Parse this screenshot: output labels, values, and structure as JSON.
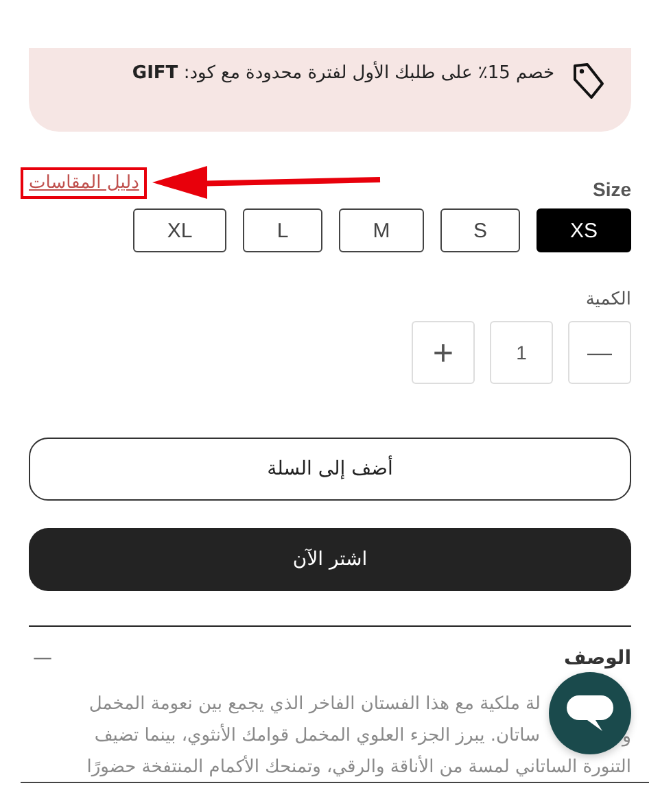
{
  "promo": {
    "text": "خصم 15٪ على طلبك الأول لفترة محدودة مع كود: **GIFT**"
  },
  "size": {
    "label": "Size",
    "guide_link": "دليل المقاسات",
    "options": [
      {
        "label": "XS",
        "selected": true
      },
      {
        "label": "S",
        "selected": false
      },
      {
        "label": "M",
        "selected": false
      },
      {
        "label": "L",
        "selected": false
      },
      {
        "label": "XL",
        "selected": false
      }
    ]
  },
  "quantity": {
    "label": "الكمية",
    "decrement": "—",
    "value": "1",
    "increment": "+"
  },
  "buttons": [
    {
      "label": "أضف إلى السلة",
      "kind": "outline"
    },
    {
      "label": "اشتر الآن",
      "kind": "filled"
    }
  ],
  "description": {
    "toggle": "—",
    "title": "الوصف",
    "lines": [
      {
        "text": "لة ملكية مع هذا الفستان الفاخر الذي يجمع بين نعومة المخمل"
      },
      {
        "start": "و",
        "text": "ساتان. يبرز الجزء العلوي المخمل قوامك الأنثوي، بينما تضيف"
      },
      {
        "text": "التنورة الساتاني لمسة من الأناقة والرقي، وتمنحك الأكمام المنتفخة حضورًا"
      }
    ]
  }
}
